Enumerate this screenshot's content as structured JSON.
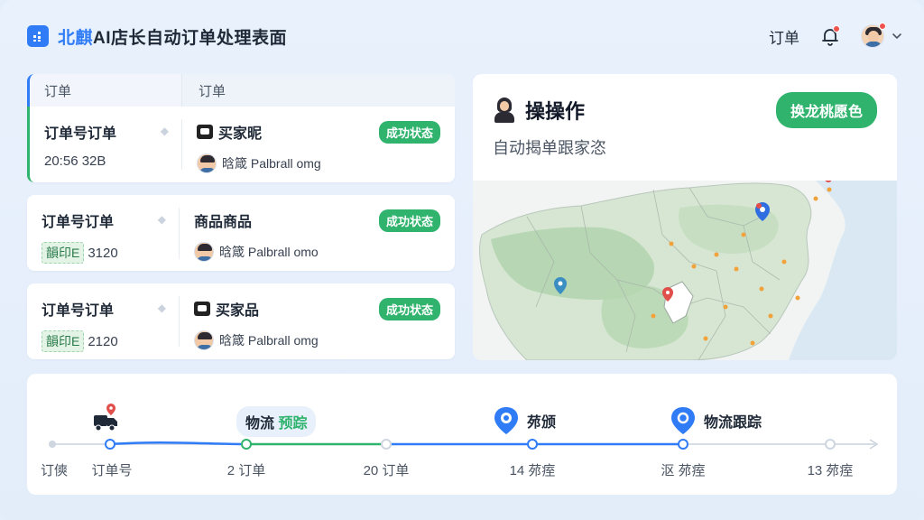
{
  "header": {
    "title_highlight": "北麒",
    "title_rest": "AI店长自动订单处理表面",
    "nav_orders": "订单",
    "icons": {
      "logo": "grid-logo-icon",
      "bell": "bell-icon",
      "chevron": "chevron-down-icon"
    }
  },
  "orders": {
    "col1": "订单",
    "col2": "订单",
    "items": [
      {
        "num": "订单号订单",
        "sub_tag": "",
        "sub_text": "20:56 32B",
        "product": "买家昵",
        "buyer": "晗箴 Palbrall omg",
        "status": "成功状态"
      },
      {
        "num": "订单号订单",
        "sub_tag": "韻印E",
        "sub_text": "3120",
        "product": "商品商品",
        "buyer": "晗箴 Palbrall omo",
        "status": "成功状态"
      },
      {
        "num": "订单号订单",
        "sub_tag": "韻印E",
        "sub_text": "2120",
        "product": "买家品",
        "buyer": "晗箴 Palbrall omg",
        "status": "成功状态"
      }
    ]
  },
  "ops": {
    "title": "操操作",
    "subtitle": "自动揭单跟家恣",
    "button": "换龙桃愿色"
  },
  "timeline": {
    "labels": [
      "订傸",
      "订单号",
      "2 订单",
      "20 订单",
      "14 茒痓",
      "沤 茒痓",
      "13 茒痓"
    ],
    "events": {
      "chip_a": "物流",
      "chip_b": "预踪",
      "event2": "茒颁",
      "event3": "物流跟踪"
    },
    "icons": [
      "truck-icon",
      "blue-pin-icon",
      "location-pin-icon"
    ]
  },
  "colors": {
    "accent": "#2f7cf6",
    "success": "#2fb36d",
    "alert": "#f0524d"
  }
}
